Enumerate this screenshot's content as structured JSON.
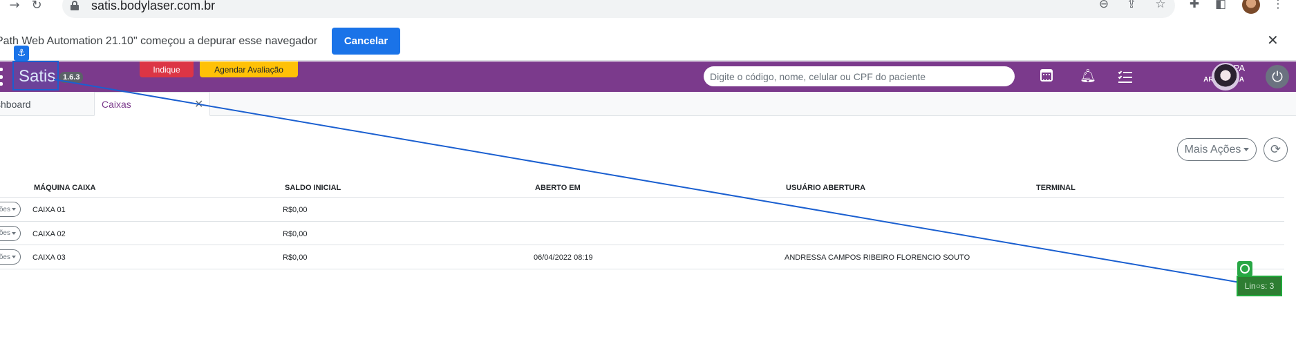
{
  "browser": {
    "back_icon": "arrow-right-icon",
    "url": "satis.bodylaser.com.br"
  },
  "infobar": {
    "message": "Path Web Automation 21.10\" começou a depurar esse navegador",
    "cancel_label": "Cancelar",
    "close": "✕"
  },
  "header": {
    "brand": "Satis",
    "version": "1.6.3",
    "indique_label": "Indique",
    "agendar_label": "Agendar Avaliação",
    "search_placeholder": "Digite o código, nome, celular ou CPF do paciente",
    "user_name": "RPA",
    "user_location": "ARARUAMA",
    "colors": {
      "primary": "#7b3a8c",
      "danger": "#dc3545",
      "warning": "#ffc107"
    }
  },
  "tabs": [
    {
      "label": "shboard"
    },
    {
      "label": "Caixas"
    }
  ],
  "actions": {
    "more_label": "Mais Ações"
  },
  "table": {
    "columns": [
      "MÁQUINA CAIXA",
      "SALDO INICIAL",
      "ABERTO EM",
      "USUÁRIO ABERTURA",
      "TERMINAL"
    ],
    "row_button_label": "ões",
    "rows": [
      {
        "maquina": "CAIXA 01",
        "saldo": "R$0,00",
        "aberto": "",
        "usuario": "",
        "terminal": ""
      },
      {
        "maquina": "CAIXA 02",
        "saldo": "R$0,00",
        "aberto": "",
        "usuario": "",
        "terminal": ""
      },
      {
        "maquina": "CAIXA 03",
        "saldo": "R$0,00",
        "aberto": "06/04/2022 08:19",
        "usuario": "ANDRESSA CAMPOS RIBEIRO FLORENCIO SOUTO",
        "terminal": ""
      }
    ]
  },
  "overlay": {
    "target_label": "Lin○s: 3"
  }
}
